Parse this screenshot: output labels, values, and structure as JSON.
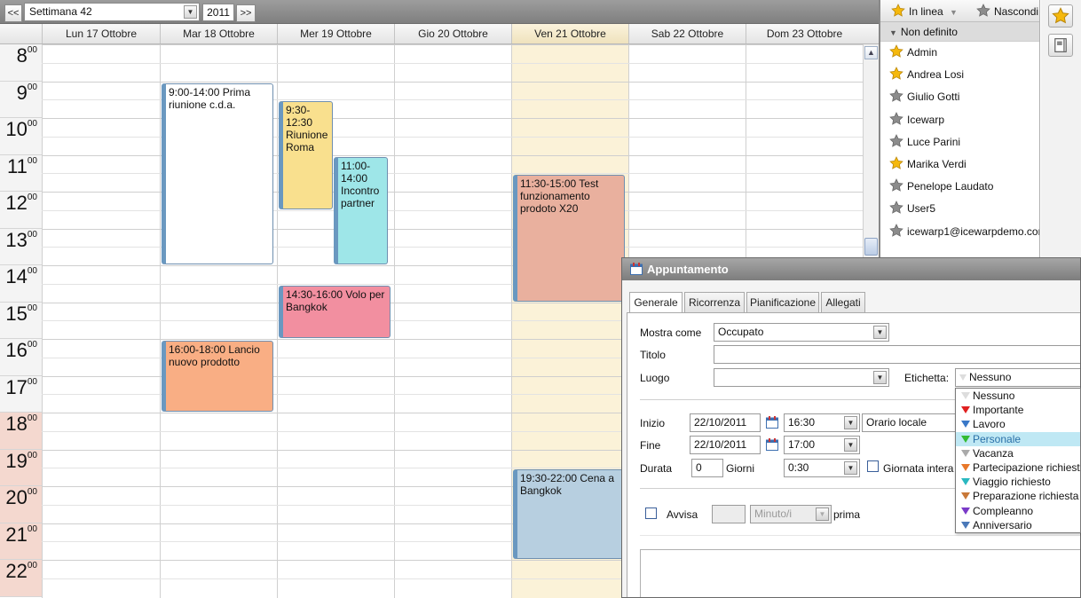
{
  "toolbar": {
    "prev_label": "<<",
    "week_select": "Settimana 42",
    "year": "2011",
    "next_label": ">>"
  },
  "days": [
    {
      "label": "Lun 17 Ottobre"
    },
    {
      "label": "Mar 18 Ottobre"
    },
    {
      "label": "Mer 19 Ottobre"
    },
    {
      "label": "Gio 20 Ottobre"
    },
    {
      "label": "Ven 21 Ottobre",
      "today": true
    },
    {
      "label": "Sab 22 Ottobre"
    },
    {
      "label": "Dom 23 Ottobre"
    }
  ],
  "hours": [
    {
      "h": "8",
      "m": "00"
    },
    {
      "h": "9",
      "m": "00"
    },
    {
      "h": "10",
      "m": "00"
    },
    {
      "h": "11",
      "m": "00"
    },
    {
      "h": "12",
      "m": "00"
    },
    {
      "h": "13",
      "m": "00"
    },
    {
      "h": "14",
      "m": "00"
    },
    {
      "h": "15",
      "m": "00"
    },
    {
      "h": "16",
      "m": "00"
    },
    {
      "h": "17",
      "m": "00"
    },
    {
      "h": "18",
      "m": "00"
    },
    {
      "h": "19",
      "m": "00"
    },
    {
      "h": "20",
      "m": "00"
    },
    {
      "h": "21",
      "m": "00"
    },
    {
      "h": "22",
      "m": "00"
    }
  ],
  "events": [
    {
      "day": 1,
      "start": 9.0,
      "end": 14.0,
      "text": "9:00-14:00 Prima riunione c.d.a.",
      "color": "#ffffff"
    },
    {
      "day": 2,
      "start": 9.5,
      "end": 12.5,
      "text": "9:30-12:30 Riunione Roma",
      "color": "#f9e08e",
      "col": 0,
      "cols": 2
    },
    {
      "day": 2,
      "start": 11.0,
      "end": 14.0,
      "text": "11:00-14:00 Incontro partner",
      "color": "#9ee6e8",
      "col": 1,
      "cols": 2
    },
    {
      "day": 2,
      "start": 14.5,
      "end": 16.0,
      "text": "14:30-16:00 Volo per Bangkok",
      "color": "#f28fa0"
    },
    {
      "day": 1,
      "start": 16.0,
      "end": 18.0,
      "text": "16:00-18:00 Lancio nuovo prodotto",
      "color": "#f9ae84"
    },
    {
      "day": 4,
      "start": 11.5,
      "end": 15.0,
      "text": "11:30-15:00 Test funzionamento prodoto X20",
      "color": "#e9b09e"
    },
    {
      "day": 4,
      "start": 19.5,
      "end": 22.0,
      "text": "19:30-22:00 Cena a Bangkok",
      "color": "#b7cfe0"
    }
  ],
  "contacts_panel": {
    "status": "In linea",
    "hide": "Nascondi",
    "group": "Non definito",
    "contacts": [
      {
        "name": "Admin",
        "online": true
      },
      {
        "name": "Andrea Losi",
        "online": true
      },
      {
        "name": "Giulio Gotti",
        "online": false
      },
      {
        "name": "Icewarp",
        "online": false
      },
      {
        "name": "Luce Parini",
        "online": false
      },
      {
        "name": "Marika Verdi",
        "online": true
      },
      {
        "name": "Penelope Laudato",
        "online": false
      },
      {
        "name": "User5",
        "online": false
      },
      {
        "name": "icewarp1@icewarpdemo.com",
        "online": false
      }
    ]
  },
  "dialog": {
    "title": "Appuntamento",
    "tabs": [
      "Generale",
      "Ricorrenza",
      "Pianificazione",
      "Allegati"
    ],
    "show_as_label": "Mostra come",
    "show_as_value": "Occupato",
    "title_label": "Titolo",
    "title_value": "",
    "location_label": "Luogo",
    "location_value": "",
    "tag_label": "Etichetta:",
    "tag_value": "Nessuno",
    "start_label": "Inizio",
    "start_date": "22/10/2011",
    "start_time": "16:30",
    "timezone": "Orario locale",
    "end_label": "Fine",
    "end_date": "22/10/2011",
    "end_time": "17:00",
    "duration_label": "Durata",
    "duration_days": "0",
    "days_label": "Giorni",
    "duration_time": "0:30",
    "all_day_label": "Giornata intera",
    "remind_label": "Avvisa",
    "remind_value": "",
    "remind_unit": "Minuto/i",
    "before_label": "prima"
  },
  "labels_list": [
    {
      "name": "Nessuno",
      "color": "#dddddd"
    },
    {
      "name": "Importante",
      "color": "#e02020"
    },
    {
      "name": "Lavoro",
      "color": "#3a78c8"
    },
    {
      "name": "Personale",
      "color": "#33bb33",
      "selected": true
    },
    {
      "name": "Vacanza",
      "color": "#aaaaaa"
    },
    {
      "name": "Partecipazione richiesta",
      "color": "#e8782a"
    },
    {
      "name": "Viaggio richiesto",
      "color": "#2ab8c0"
    },
    {
      "name": "Preparazione richiesta",
      "color": "#c87838"
    },
    {
      "name": "Compleanno",
      "color": "#7a3ac8"
    },
    {
      "name": "Anniversario",
      "color": "#4a78b8"
    }
  ],
  "icons": {
    "online_star": "star-icon",
    "offline_star": "grey-star-icon",
    "calendar": "calendar-icon"
  }
}
